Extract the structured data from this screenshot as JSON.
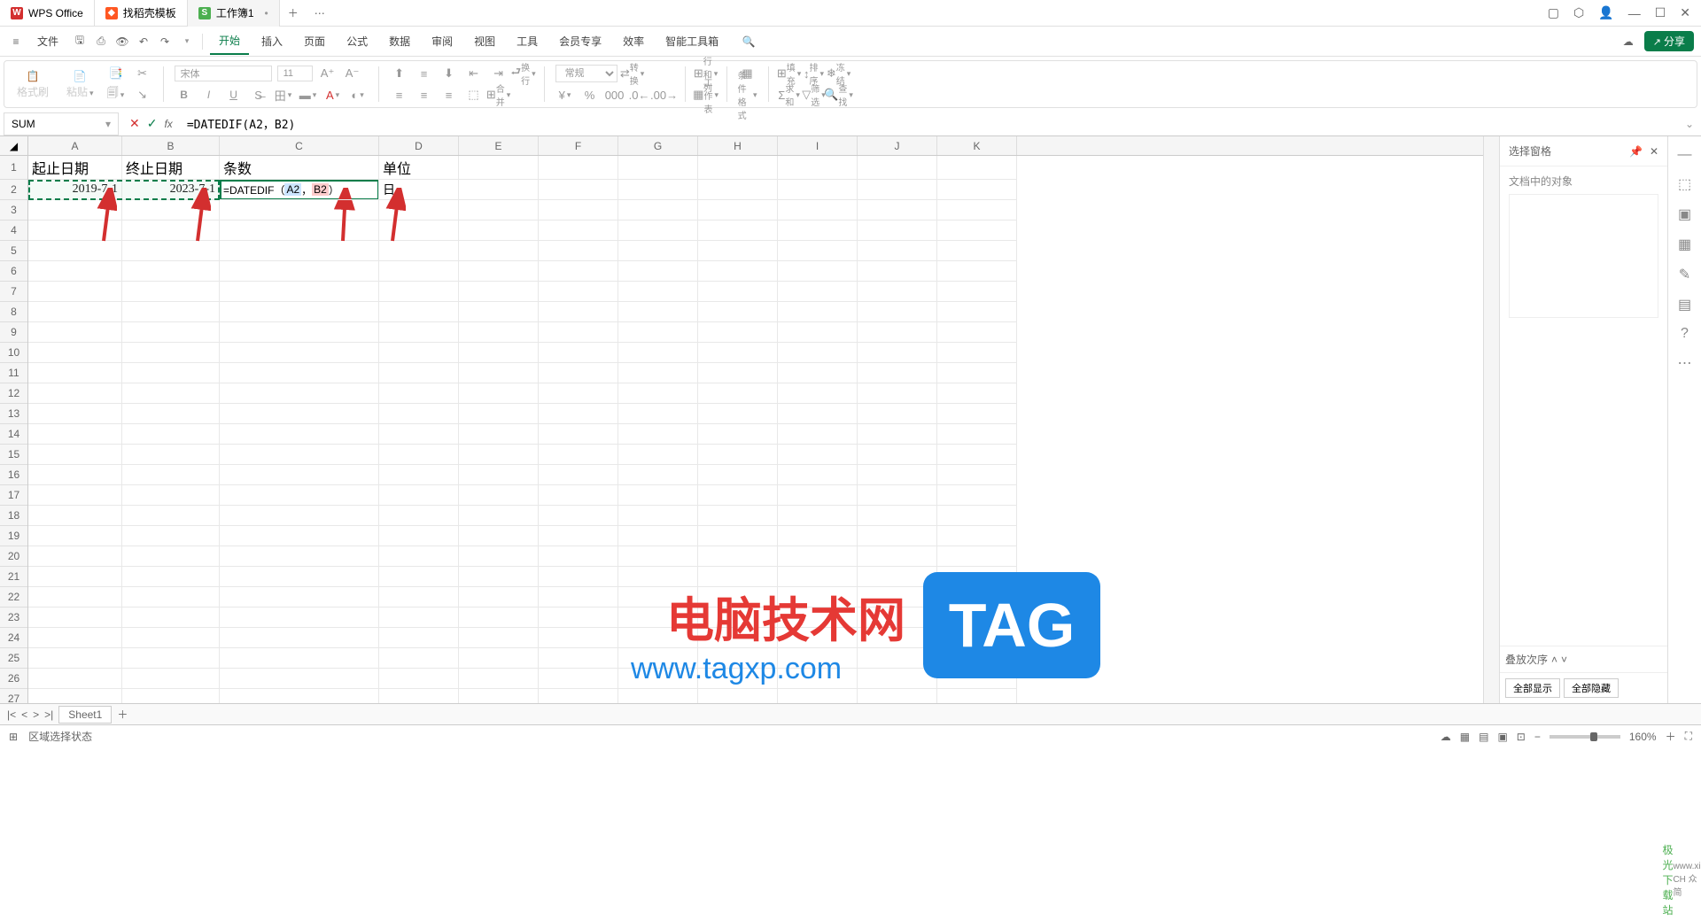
{
  "tabs": {
    "wps": "WPS Office",
    "template": "找稻壳模板",
    "workbook": "工作簿1"
  },
  "menu": {
    "file": "文件",
    "start": "开始",
    "insert": "插入",
    "page": "页面",
    "formula": "公式",
    "data": "数据",
    "review": "审阅",
    "view": "视图",
    "tools": "工具",
    "member": "会员专享",
    "efficiency": "效率",
    "smart": "智能工具箱"
  },
  "ribbon": {
    "format_painter": "格式刷",
    "paste": "粘贴",
    "font_name": "宋体",
    "font_size": "11",
    "wrap": "换行",
    "merge": "合并",
    "general": "常规",
    "convert": "转换",
    "row_col": "行和列",
    "worksheet": "工作表",
    "cond_fmt": "条件格式",
    "fill": "填充",
    "sort": "排序",
    "freeze": "冻结",
    "sum": "求和",
    "filter": "筛选",
    "find": "查找"
  },
  "share_label": "分享",
  "namebox": "SUM",
  "formula_text": "=DATEDIF(A2，B2)",
  "columns": [
    "A",
    "B",
    "C",
    "D",
    "E",
    "F",
    "G",
    "H",
    "I",
    "J",
    "K"
  ],
  "rows_count": 27,
  "cells": {
    "A1": "起止日期",
    "B1": "终止日期",
    "C1": "条数",
    "D1": "单位",
    "A2": "2019-7-1",
    "B2": "2023-7-1",
    "C2_prefix": "=DATEDIF（",
    "C2_ref1": "A2",
    "C2_comma": "，",
    "C2_ref2": "B2",
    "C2_suffix": "）",
    "D2": "日"
  },
  "side": {
    "title": "选择窗格",
    "doc_objects": "文档中的对象",
    "stack_order": "叠放次序",
    "show_all": "全部显示",
    "hide_all": "全部隐藏"
  },
  "sheet_tab": "Sheet1",
  "status": {
    "mode": "区域选择状态",
    "zoom": "160%"
  },
  "watermark": {
    "text": "电脑技术网",
    "url": "www.tagxp.com",
    "tag": "TAG",
    "corner1": "极光下载站",
    "corner2": "www.xi CH 众简"
  }
}
